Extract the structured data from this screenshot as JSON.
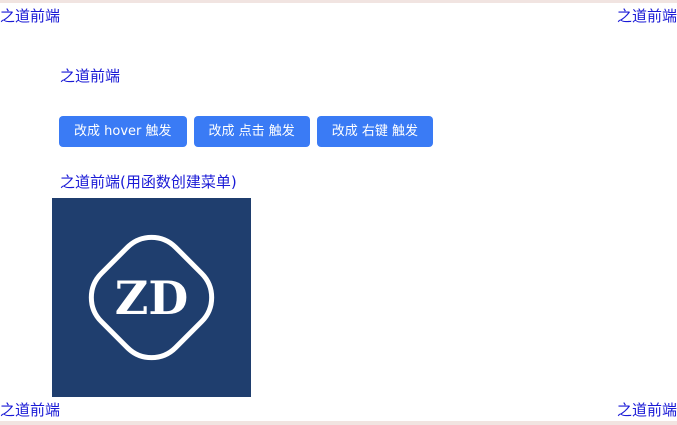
{
  "corners": {
    "top_left": "之道前端",
    "top_right": "之道前端",
    "bottom_left": "之道前端",
    "bottom_right": "之道前端"
  },
  "heading": "之道前端",
  "buttons": [
    {
      "label": "改成 hover 触发"
    },
    {
      "label": "改成 点击 触发"
    },
    {
      "label": "改成 右键 触发"
    }
  ],
  "menu_title": "之道前端(用函数创建菜单)",
  "logo": {
    "text": "ZD",
    "background": "#1f3e6e"
  },
  "colors": {
    "link": "#1a1ad6",
    "button": "#3a7bf5"
  }
}
